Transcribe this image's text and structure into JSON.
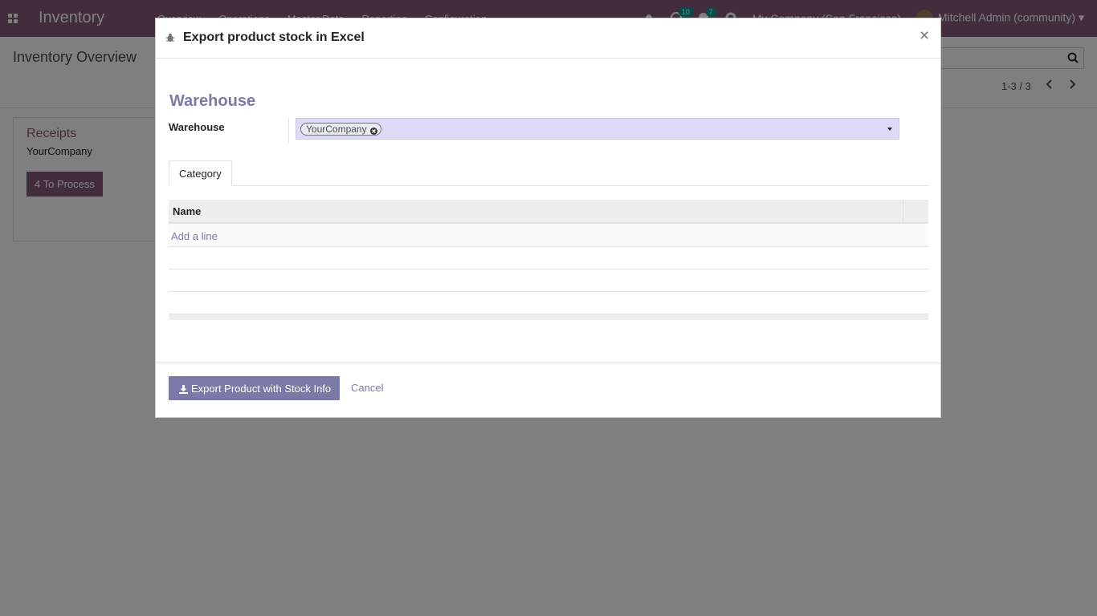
{
  "navbar": {
    "app_title": "Inventory",
    "menu": [
      "Overview",
      "Operations",
      "Master Data",
      "Reporting",
      "Configuration"
    ],
    "activity_count": "10",
    "message_count": "7",
    "company": "My Company (San Francisco)",
    "user": "Mitchell Admin (community)"
  },
  "control_panel": {
    "title": "Inventory Overview",
    "pager": "1-3 / 3"
  },
  "kanban": {
    "card_title": "Receipts",
    "card_company": "YourCompany",
    "card_button": "4 To Process"
  },
  "modal": {
    "title": "Export product stock in Excel",
    "close_symbol": "×",
    "group_title": "Warehouse",
    "field_label": "Warehouse",
    "warehouse_tag": "YourCompany",
    "tab_label": "Category",
    "table_header_name": "Name",
    "add_line": "Add a line",
    "export_button": "Export Product with Stock Info",
    "cancel_button": "Cancel"
  },
  "colors": {
    "brand": "#875A7B",
    "accent": "#7a79a8",
    "select_bg": "#dcdaf7"
  }
}
